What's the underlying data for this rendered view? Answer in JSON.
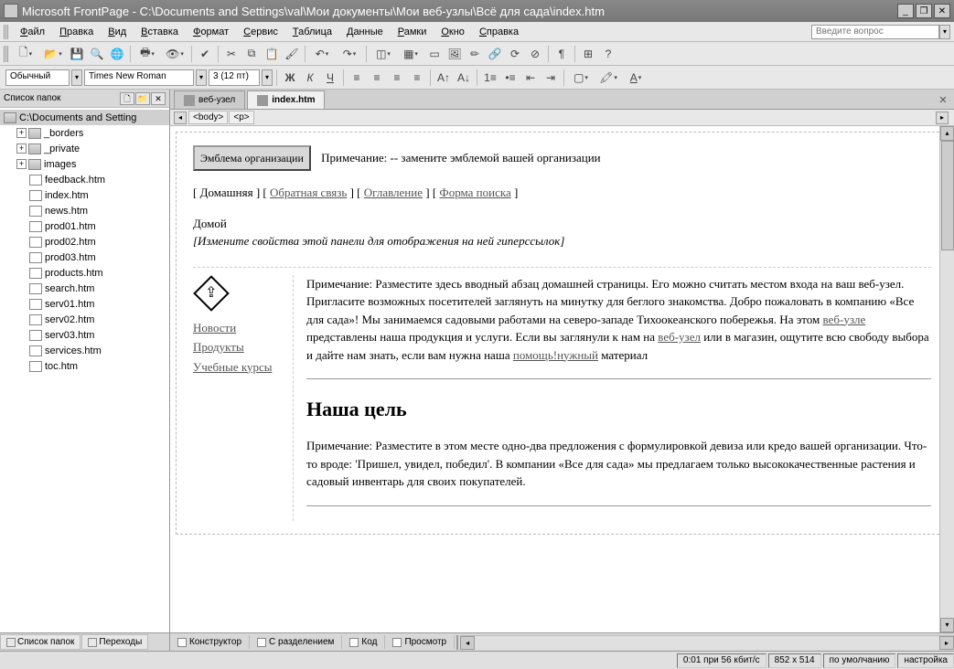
{
  "titlebar": {
    "app": "Microsoft FrontPage",
    "path": "C:\\Documents and Settings\\val\\Мои документы\\Мои веб-узлы\\Всё для сада\\index.htm"
  },
  "menu": [
    "Файл",
    "Правка",
    "Вид",
    "Вставка",
    "Формат",
    "Сервис",
    "Таблица",
    "Данные",
    "Рамки",
    "Окно",
    "Справка"
  ],
  "askbox_placeholder": "Введите вопрос",
  "format": {
    "style": "Обычный",
    "font": "Times New Roman",
    "size": "3 (12 пт)"
  },
  "folderpane": {
    "title": "Список папок",
    "root": "C:\\Documents and Setting",
    "folders": [
      "_borders",
      "_private",
      "images"
    ],
    "files": [
      "feedback.htm",
      "index.htm",
      "news.htm",
      "prod01.htm",
      "prod02.htm",
      "prod03.htm",
      "products.htm",
      "search.htm",
      "serv01.htm",
      "serv02.htm",
      "serv03.htm",
      "services.htm",
      "toc.htm"
    ]
  },
  "tabs": [
    {
      "label": "веб-узел",
      "active": false
    },
    {
      "label": "index.htm",
      "active": true
    }
  ],
  "breadcrumb": [
    "<body>",
    "<p>"
  ],
  "page": {
    "emblem_btn": "Эмблема организации",
    "emblem_note": "Примечание: -- замените эмблемой вашей организации",
    "nav": [
      "Домашняя",
      "Обратная связь",
      "Оглавление",
      "Форма поиска"
    ],
    "home_label": "Домой",
    "panel_hint": "[Измените свойства этой панели для отображения на ней гиперссылок]",
    "side_links": [
      "Новости",
      "Продукты",
      "Учебные курсы"
    ],
    "intro_prefix": "Примечание: Разместите здесь вводный абзац домашней страницы. Его можно считать местом входа на ваш веб-узел. Пригласите возможных посетителей заглянуть на минутку для беглого знакомства. Добро пожаловать в компанию «Все для сада»! Мы занимаемся садовыми работами на северо-западе Тихоокеанского побережья. На этом ",
    "intro_link1": "веб-узле",
    "intro_mid1": " представлены наша продукция и услуги. Если вы заглянули к нам на ",
    "intro_link2": "веб-узел",
    "intro_mid2": " или в магазин, ощутите всю свободу выбора и дайте нам знать, если вам нужна наша ",
    "intro_link3": "помощь!нужный",
    "intro_suffix": " материал",
    "heading": "Наша цель",
    "mission": "Примечание: Разместите в этом месте одно-два предложения с формулировкой девиза или кредо вашей организации. Что-то вроде: 'Пришел, увидел, победил'. В компании «Все для сада» мы предлагаем только высококачественные растения и садовый инвентарь для своих покупателей."
  },
  "bottom_tabs": [
    "Список папок",
    "Переходы"
  ],
  "view_tabs": [
    "Конструктор",
    "С разделением",
    "Код",
    "Просмотр"
  ],
  "status": {
    "speed": "0:01 при 56 кбит/с",
    "dims": "852 x 514",
    "mode": "по умолчанию",
    "config": "настройка"
  }
}
